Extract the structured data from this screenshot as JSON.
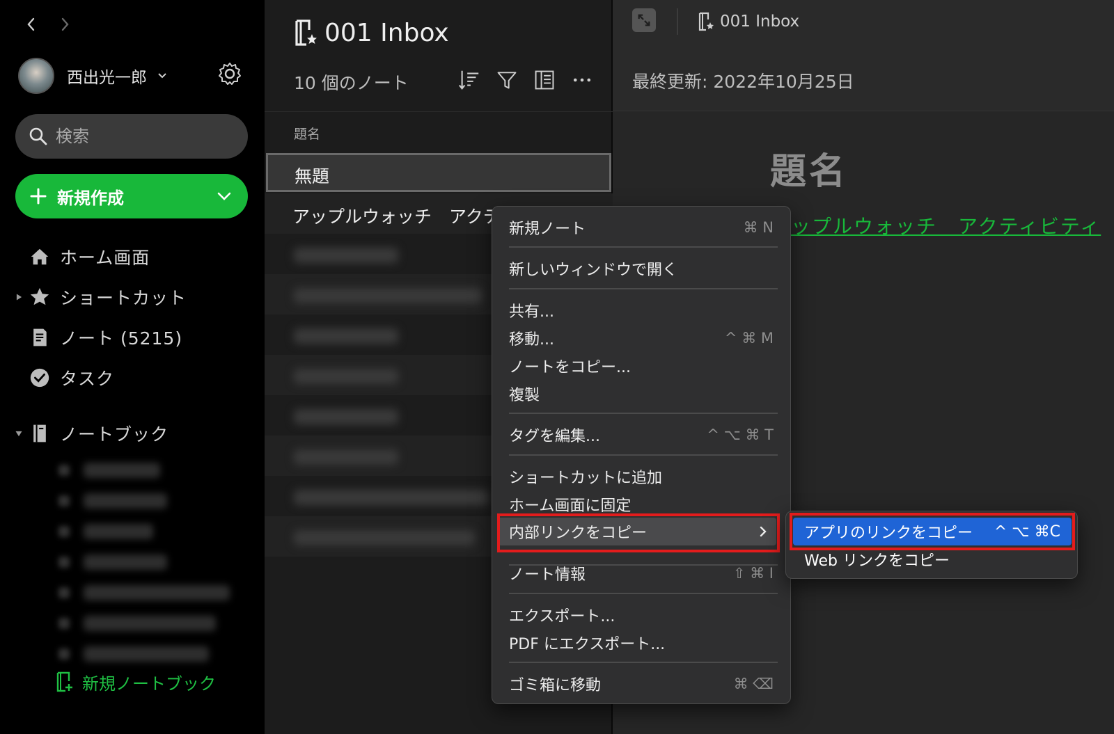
{
  "sidebar": {
    "user_name": "西出光一郎",
    "search": {
      "placeholder": "検索"
    },
    "new_button_label": "新規作成",
    "items": [
      {
        "label": "ホーム画面"
      },
      {
        "label": "ショートカット"
      },
      {
        "label": "ノート (5215)"
      },
      {
        "label": "タスク"
      },
      {
        "label": "ノートブック"
      }
    ],
    "new_notebook_label": "新規ノートブック"
  },
  "note_list": {
    "notebook_title": "001 Inbox",
    "note_count": "10 個のノート",
    "column_header": "題名",
    "notes": [
      {
        "title": "無題"
      },
      {
        "title": "アップルウォッチ　アクテ"
      }
    ]
  },
  "editor": {
    "breadcrumb": "001 Inbox",
    "last_updated": "最終更新: 2022年10月25日",
    "heading": "題名",
    "link_text": "ップルウォッチ　アクティビティ"
  },
  "context_menu": {
    "items": [
      {
        "label": "新規ノート",
        "shortcut": "⌘ N"
      },
      {
        "label": "新しいウィンドウで開く",
        "shortcut": ""
      },
      {
        "label": "共有...",
        "shortcut": ""
      },
      {
        "label": "移動...",
        "shortcut": "^ ⌘ M"
      },
      {
        "label": "ノートをコピー...",
        "shortcut": ""
      },
      {
        "label": "複製",
        "shortcut": ""
      },
      {
        "label": "タグを編集...",
        "shortcut": "^ ⌥ ⌘ T"
      },
      {
        "label": "ショートカットに追加",
        "shortcut": ""
      },
      {
        "label": "ホーム画面に固定",
        "shortcut": ""
      },
      {
        "label": "内部リンクをコピー",
        "shortcut": ""
      },
      {
        "label": "ノート情報",
        "shortcut": "⇧ ⌘ I"
      },
      {
        "label": "エクスポート...",
        "shortcut": ""
      },
      {
        "label": "PDF にエクスポート...",
        "shortcut": ""
      },
      {
        "label": "ゴミ箱に移動",
        "shortcut": "⌘ ⌫"
      }
    ]
  },
  "submenu": {
    "items": [
      {
        "label": "アプリのリンクをコピー",
        "shortcut": "^ ⌥ ⌘C"
      },
      {
        "label": "Web リンクをコピー",
        "shortcut": ""
      }
    ]
  },
  "colors": {
    "accent_green": "#18b83a",
    "highlight_red": "#e31c1c",
    "menu_selection_blue": "#1f64d6"
  }
}
